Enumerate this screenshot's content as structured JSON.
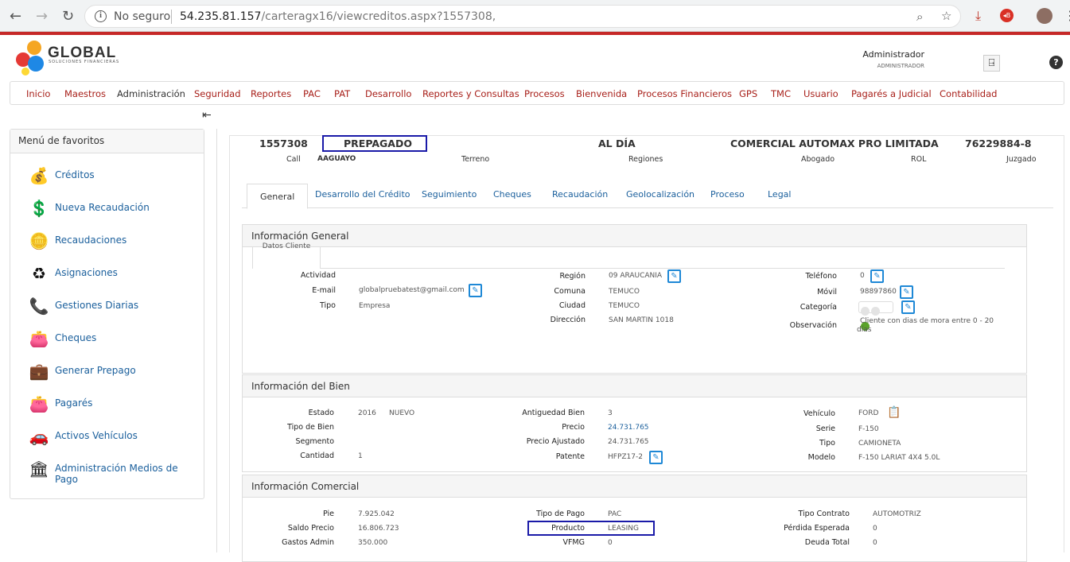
{
  "browser": {
    "insecure_label": "No seguro",
    "url_host": "54.235.81.157",
    "url_path": "/carteragx16/viewcreditos.aspx?1557308,"
  },
  "header": {
    "logo_text": "GLOBAL",
    "logo_sub": "SOLUCIONES FINANCIERAS",
    "user_name": "Administrador",
    "user_role": "ADMINISTRADOR"
  },
  "menu": [
    "Inicio",
    "Maestros",
    "Administración",
    "Seguridad",
    "Reportes",
    "PAC",
    "PAT",
    "Desarrollo",
    "Reportes y Consultas",
    "Procesos",
    "Bienvenida",
    "Procesos Financieros",
    "GPS",
    "TMC",
    "Usuario",
    "Pagarés a Judicial",
    "Contabilidad"
  ],
  "favorites": {
    "title": "Menú de favoritos",
    "items": [
      "Créditos",
      "Nueva Recaudación",
      "Recaudaciones",
      "Asignaciones",
      "Gestiones Diarias",
      "Cheques",
      "Generar Prepago",
      "Pagarés",
      "Activos Vehículos",
      "Administración Medios de Pago"
    ]
  },
  "credit": {
    "number": "1557308",
    "status": "PREPAGADO",
    "state": "AL DÍA",
    "client": "COMERCIAL AUTOMAX PRO LIMITADA",
    "rut": "76229884-8",
    "call_label": "Call",
    "call_value": "AAGUAYO",
    "terreno_label": "Terreno",
    "regiones_label": "Regiones",
    "abogado_label": "Abogado",
    "rol_label": "ROL",
    "juzgado_label": "Juzgado"
  },
  "tabs": [
    "General",
    "Desarrollo del Crédito",
    "Seguimiento",
    "Cheques",
    "Recaudación",
    "Geolocalización",
    "Proceso",
    "Legal"
  ],
  "info_general": {
    "title": "Información General",
    "subtab": "Datos Cliente",
    "actividad_label": "Actividad",
    "email_label": "E-mail",
    "email": "globalpruebatest@gmail.com",
    "tipo_label": "Tipo",
    "tipo": "Empresa",
    "region_label": "Región",
    "region": "09 ARAUCANIA",
    "comuna_label": "Comuna",
    "comuna": "TEMUCO",
    "ciudad_label": "Ciudad",
    "ciudad": "TEMUCO",
    "direccion_label": "Dirección",
    "direccion": "SAN MARTIN 1018",
    "telefono_label": "Teléfono",
    "telefono": "0",
    "movil_label": "Móvil",
    "movil": "98897860",
    "categoria_label": "Categoría",
    "observacion_label": "Observación",
    "observacion_1": "Cliente con dias de mora entre 0 - 20",
    "observacion_2": "días"
  },
  "info_bien": {
    "title": "Información del Bien",
    "estado_label": "Estado",
    "estado_year": "2016",
    "estado": "NUEVO",
    "tipo_bien_label": "Tipo de Bien",
    "segmento_label": "Segmento",
    "cantidad_label": "Cantidad",
    "cantidad": "1",
    "antiguedad_label": "Antiguedad Bien",
    "antiguedad": "3",
    "precio_label": "Precio",
    "precio": "24.731.765",
    "precio_aj_label": "Precio Ajustado",
    "precio_aj": "24.731.765",
    "patente_label": "Patente",
    "patente": "HFPZ17-2",
    "vehiculo_label": "Vehículo",
    "vehiculo": "FORD",
    "serie_label": "Serie",
    "serie": "F-150",
    "tipo_label": "Tipo",
    "tipo": "CAMIONETA",
    "modelo_label": "Modelo",
    "modelo": "F-150 LARIAT 4X4 5.0L"
  },
  "info_comercial": {
    "title": "Información Comercial",
    "pie_label": "Pie",
    "pie": "7.925.042",
    "saldo_label": "Saldo Precio",
    "saldo": "16.806.723",
    "gastos_label": "Gastos Admin",
    "gastos": "350.000",
    "tipo_pago_label": "Tipo de Pago",
    "tipo_pago": "PAC",
    "producto_label": "Producto",
    "producto": "LEASING",
    "vfmg_label": "VFMG",
    "vfmg": "0",
    "tipo_contrato_label": "Tipo Contrato",
    "tipo_contrato": "AUTOMOTRIZ",
    "perdida_label": "Pérdida Esperada",
    "perdida": "0",
    "deuda_label": "Deuda Total",
    "deuda": "0"
  }
}
